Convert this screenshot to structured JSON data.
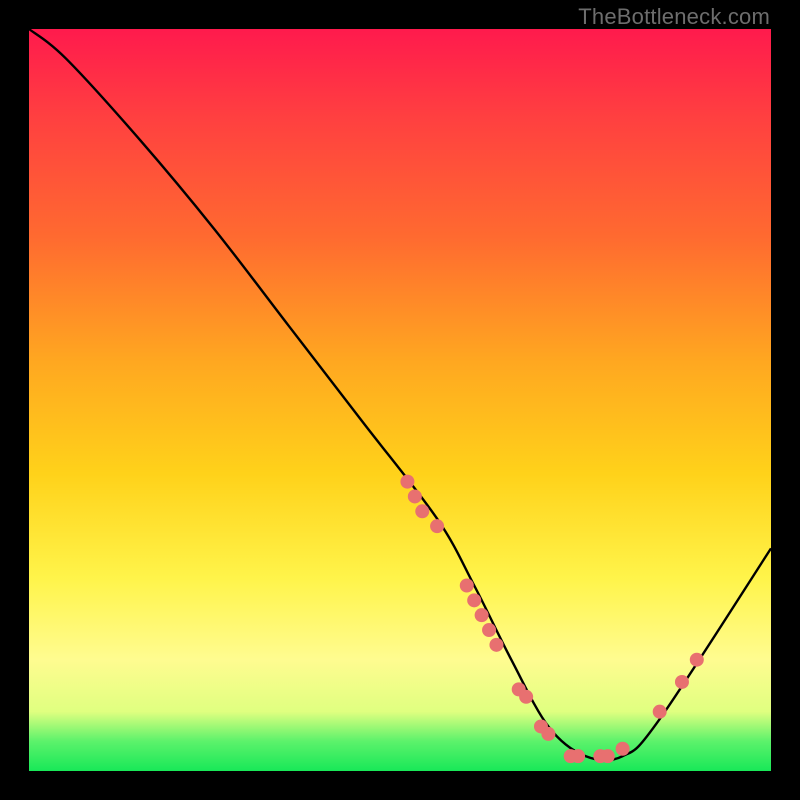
{
  "attribution": "TheBottleneck.com",
  "chart_data": {
    "type": "line",
    "title": "",
    "xlabel": "",
    "ylabel": "",
    "xlim": [
      0,
      100
    ],
    "ylim": [
      0,
      100
    ],
    "series": [
      {
        "name": "bottleneck-curve",
        "x": [
          0,
          5,
          15,
          25,
          35,
          45,
          55,
          60,
          65,
          70,
          75,
          80,
          85,
          100
        ],
        "y": [
          100,
          96,
          85,
          73,
          60,
          47,
          34,
          25,
          15,
          6,
          2,
          2,
          7,
          30
        ]
      }
    ],
    "markers": {
      "name": "sample-points",
      "color": "#e87070",
      "points": [
        {
          "x": 51,
          "y": 39
        },
        {
          "x": 52,
          "y": 37
        },
        {
          "x": 53,
          "y": 35
        },
        {
          "x": 55,
          "y": 33
        },
        {
          "x": 59,
          "y": 25
        },
        {
          "x": 60,
          "y": 23
        },
        {
          "x": 61,
          "y": 21
        },
        {
          "x": 62,
          "y": 19
        },
        {
          "x": 63,
          "y": 17
        },
        {
          "x": 66,
          "y": 11
        },
        {
          "x": 67,
          "y": 10
        },
        {
          "x": 69,
          "y": 6
        },
        {
          "x": 70,
          "y": 5
        },
        {
          "x": 73,
          "y": 2
        },
        {
          "x": 74,
          "y": 2
        },
        {
          "x": 77,
          "y": 2
        },
        {
          "x": 78,
          "y": 2
        },
        {
          "x": 80,
          "y": 3
        },
        {
          "x": 85,
          "y": 8
        },
        {
          "x": 88,
          "y": 12
        },
        {
          "x": 90,
          "y": 15
        }
      ]
    },
    "gradient_stops": [
      {
        "pos": 0.0,
        "color": "#ff1a4d"
      },
      {
        "pos": 0.45,
        "color": "#ffa820"
      },
      {
        "pos": 0.74,
        "color": "#fff44a"
      },
      {
        "pos": 0.96,
        "color": "#5cf26b"
      },
      {
        "pos": 1.0,
        "color": "#18e858"
      }
    ]
  }
}
